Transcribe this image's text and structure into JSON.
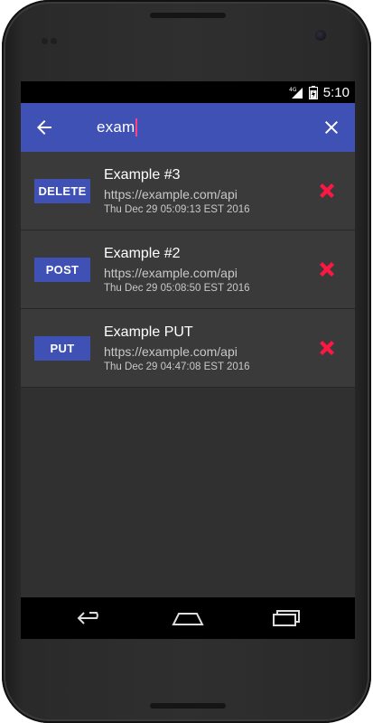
{
  "status_bar": {
    "network": "4G",
    "time": "5:10",
    "icons": [
      "signal-icon",
      "battery-icon"
    ]
  },
  "app_bar": {
    "search_value": "exam",
    "back_icon": "arrow-left-icon",
    "clear_icon": "close-icon",
    "color": "#3f51b5"
  },
  "requests": [
    {
      "method": "DELETE",
      "title": "Example #3",
      "url": "https://example.com/api",
      "time": "Thu Dec 29 05:09:13 EST 2016"
    },
    {
      "method": "POST",
      "title": "Example #2",
      "url": "https://example.com/api",
      "time": "Thu Dec 29 05:08:50 EST 2016"
    },
    {
      "method": "PUT",
      "title": "Example PUT",
      "url": "https://example.com/api",
      "time": "Thu Dec 29 04:47:08 EST 2016"
    }
  ],
  "colors": {
    "accent": "#ff4081",
    "delete_icon": "#ff1744",
    "method_badge": "#3f51b5",
    "background": "#303030"
  },
  "nav_bar": {
    "icons": [
      "back-nav-icon",
      "home-nav-icon",
      "recents-nav-icon"
    ]
  }
}
